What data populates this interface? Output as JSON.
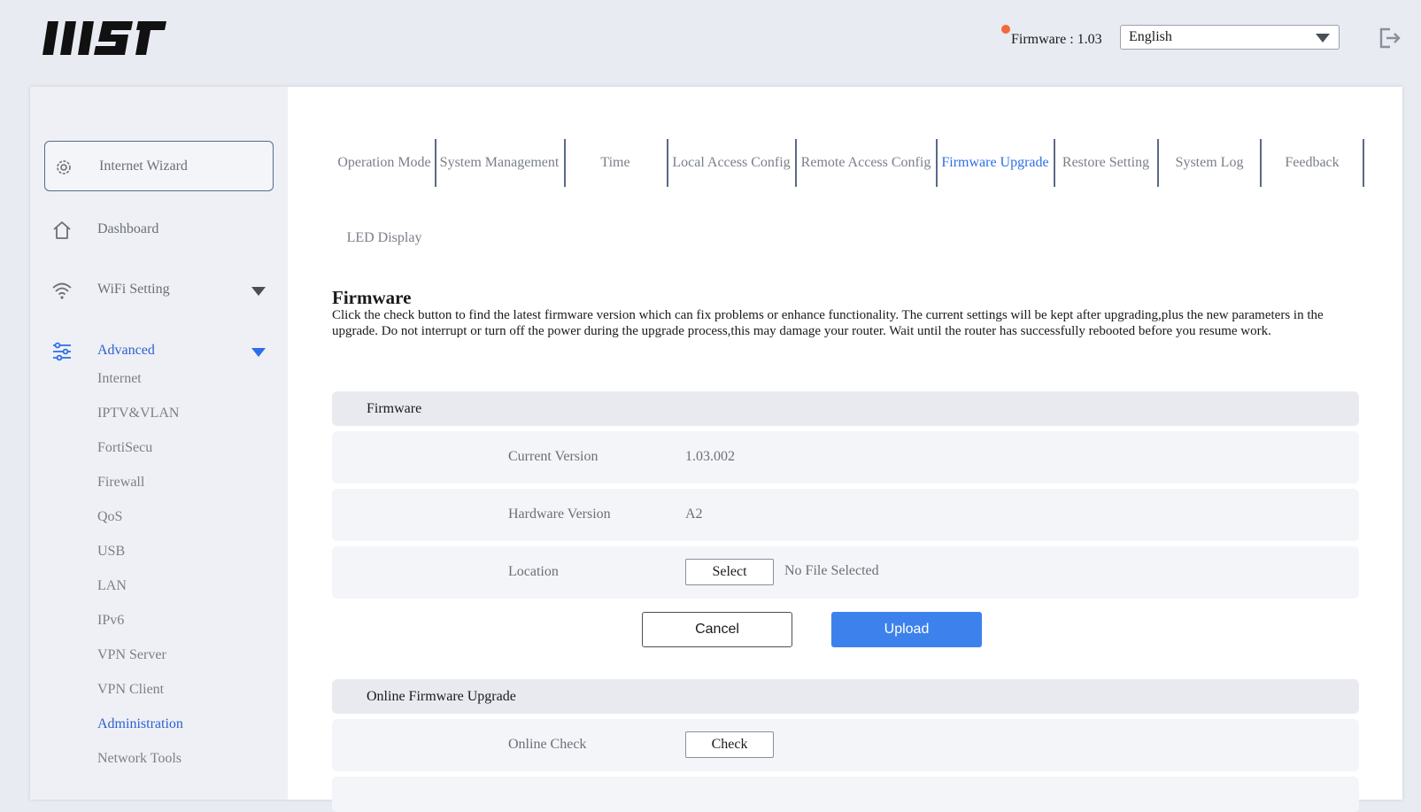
{
  "header": {
    "logo_text": "MSI",
    "firmware_label": "Firmware : 1.03",
    "language": {
      "selected": "English"
    }
  },
  "sidebar": {
    "wizard_label": "Internet Wizard",
    "items": [
      {
        "label": "Dashboard",
        "icon": "home-icon"
      },
      {
        "label": "WiFi Setting",
        "icon": "wifi-icon"
      },
      {
        "label": "Advanced",
        "icon": "sliders-icon"
      }
    ],
    "sub_items": [
      "Internet",
      "IPTV&VLAN",
      "FortiSecu",
      "Firewall",
      "QoS",
      "USB",
      "LAN",
      "IPv6",
      "VPN Server",
      "VPN Client",
      "Administration",
      "Network Tools"
    ],
    "active_sub": "Administration"
  },
  "tabs": [
    "Operation Mode",
    "System Management",
    "Time",
    "Local Access Config",
    "Remote Access Config",
    "Firmware Upgrade",
    "Restore Setting",
    "System Log",
    "Feedback",
    "LED Display"
  ],
  "active_tab": "Firmware Upgrade",
  "main": {
    "title": "Firmware",
    "description": "Click the check button to find the latest firmware version which can fix problems or enhance functionality. The current settings will be kept after upgrading,plus the new parameters in the upgrade. Do not interrupt or turn off the power during the upgrade process,this may damage your router. Wait until the router has successfully rebooted before you resume work.",
    "firmware_section": {
      "header": "Firmware",
      "current_version_label": "Current Version",
      "current_version": "1.03.002",
      "hardware_version_label": "Hardware Version",
      "hardware_version": "A2",
      "location_label": "Location",
      "select_button": "Select",
      "no_file": "No File Selected",
      "cancel_button": "Cancel",
      "upload_button": "Upload"
    },
    "online_section": {
      "header": "Online Firmware Upgrade",
      "online_check_label": "Online Check",
      "check_button": "Check"
    }
  },
  "colors": {
    "accent": "#2c6ee6",
    "upload_button": "#3d82ec",
    "notification_dot": "#f06a3a",
    "background": "#e8ebf2"
  }
}
